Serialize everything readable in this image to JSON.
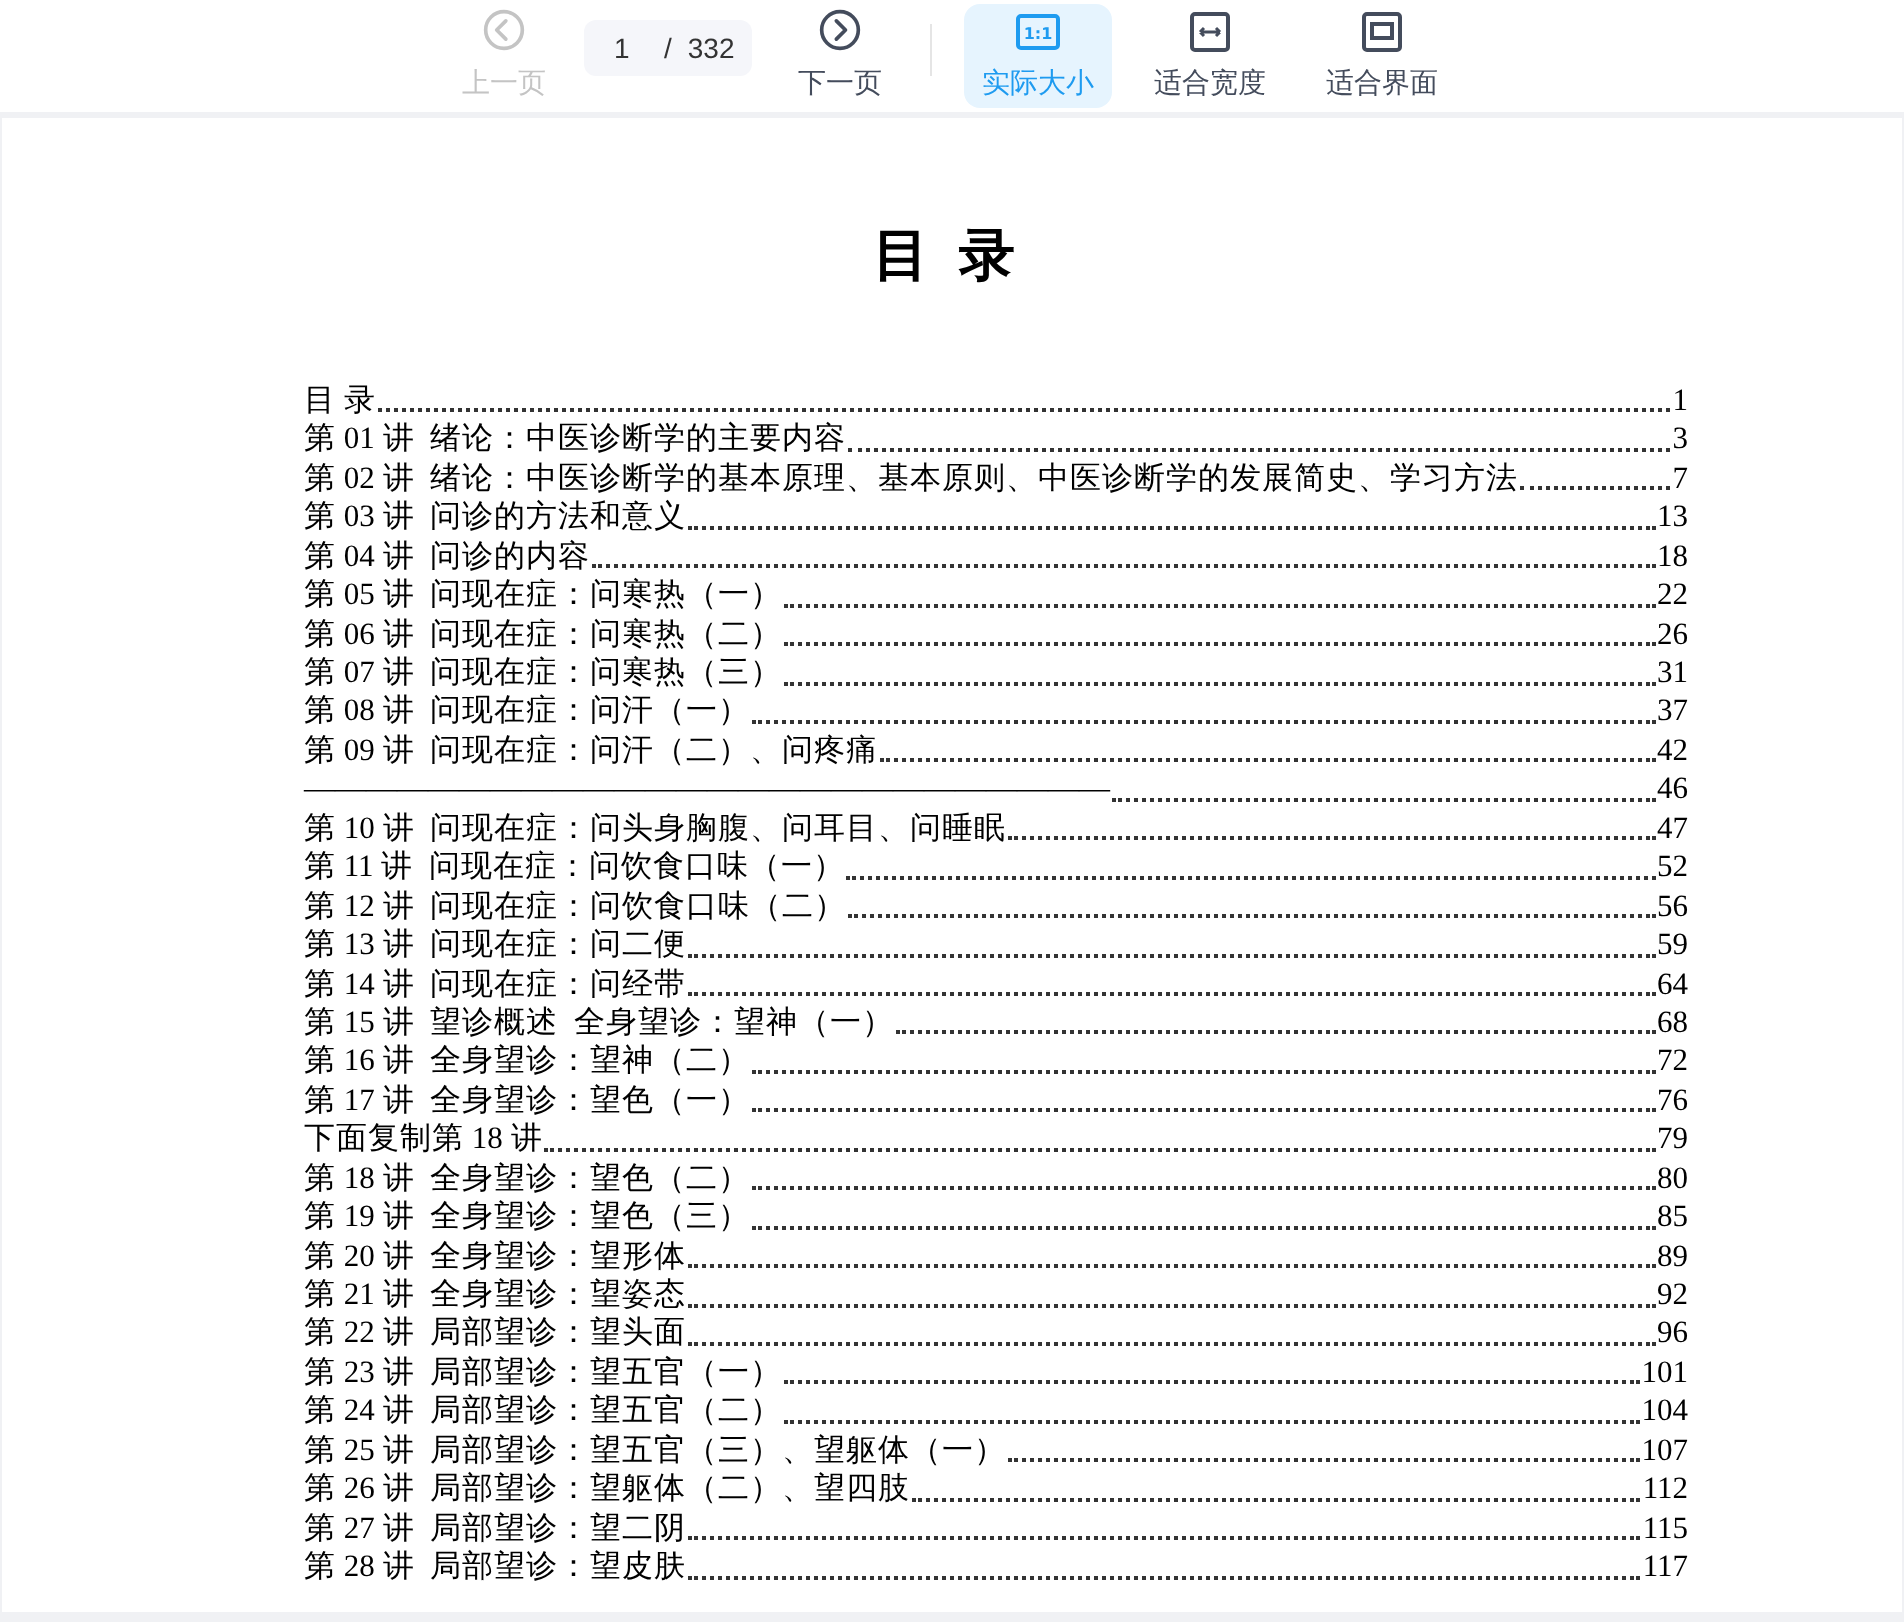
{
  "toolbar": {
    "prev": {
      "label": "上一页",
      "disabled": true
    },
    "page": {
      "value": "1",
      "separator": "/",
      "total": "332"
    },
    "next": {
      "label": "下一页",
      "disabled": false
    },
    "view_modes": [
      {
        "label": "实际大小",
        "selected": true,
        "icon_text": "1:1"
      },
      {
        "label": "适合宽度",
        "selected": false
      },
      {
        "label": "适合界面",
        "selected": false
      }
    ]
  },
  "document": {
    "heading": "目 录",
    "toc": [
      {
        "title": "目 录",
        "page": "1"
      },
      {
        "title": "第 01 讲  绪论：中医诊断学的主要内容",
        "page": "3"
      },
      {
        "title": "第 02 讲  绪论：中医诊断学的基本原理、基本原则、中医诊断学的发展简史、学习方法",
        "page": "7"
      },
      {
        "title": "第 03 讲  问诊的方法和意义",
        "page": "13"
      },
      {
        "title": "第 04 讲  问诊的内容",
        "page": "18"
      },
      {
        "title": "第 05 讲  问现在症：问寒热（一）",
        "page": "22"
      },
      {
        "title": "第 06 讲  问现在症：问寒热（二）",
        "page": "26"
      },
      {
        "title": "第 07 讲  问现在症：问寒热（三）",
        "page": "31"
      },
      {
        "title": "第 08 讲  问现在症：问汗（一）",
        "page": "37"
      },
      {
        "title": "第 09 讲  问现在症：问汗（二）、问疼痛",
        "page": "42"
      },
      {
        "title": "——————————————————————————",
        "page": "46"
      },
      {
        "title": "第 10 讲  问现在症：问头身胸腹、问耳目、问睡眠",
        "page": "47"
      },
      {
        "title": "第 11 讲  问现在症：问饮食口味（一）",
        "page": "52"
      },
      {
        "title": "第 12 讲  问现在症：问饮食口味（二）",
        "page": "56"
      },
      {
        "title": "第 13 讲  问现在症：问二便",
        "page": "59"
      },
      {
        "title": "第 14 讲  问现在症：问经带",
        "page": "64"
      },
      {
        "title": "第 15 讲  望诊概述  全身望诊：望神（一）",
        "page": "68"
      },
      {
        "title": "第 16 讲  全身望诊：望神（二）",
        "page": "72"
      },
      {
        "title": "第 17 讲  全身望诊：望色（一）",
        "page": "76"
      },
      {
        "title": "下面复制第 18 讲",
        "page": "79"
      },
      {
        "title": "第 18 讲  全身望诊：望色（二）",
        "page": "80"
      },
      {
        "title": "第 19 讲  全身望诊：望色（三）",
        "page": "85"
      },
      {
        "title": "第 20 讲  全身望诊：望形体",
        "page": "89"
      },
      {
        "title": "第 21 讲  全身望诊：望姿态",
        "page": "92"
      },
      {
        "title": "第 22 讲  局部望诊：望头面",
        "page": "96"
      },
      {
        "title": "第 23 讲  局部望诊：望五官（一）",
        "page": "101"
      },
      {
        "title": "第 24 讲  局部望诊：望五官（二）",
        "page": "104"
      },
      {
        "title": "第 25 讲  局部望诊：望五官（三）、望躯体（一）",
        "page": "107"
      },
      {
        "title": "第 26 讲  局部望诊：望躯体（二）、望四肢",
        "page": "112"
      },
      {
        "title": "第 27 讲  局部望诊：望二阴",
        "page": "115"
      },
      {
        "title": "第 28 讲  局部望诊：望皮肤",
        "page": "117"
      }
    ]
  }
}
